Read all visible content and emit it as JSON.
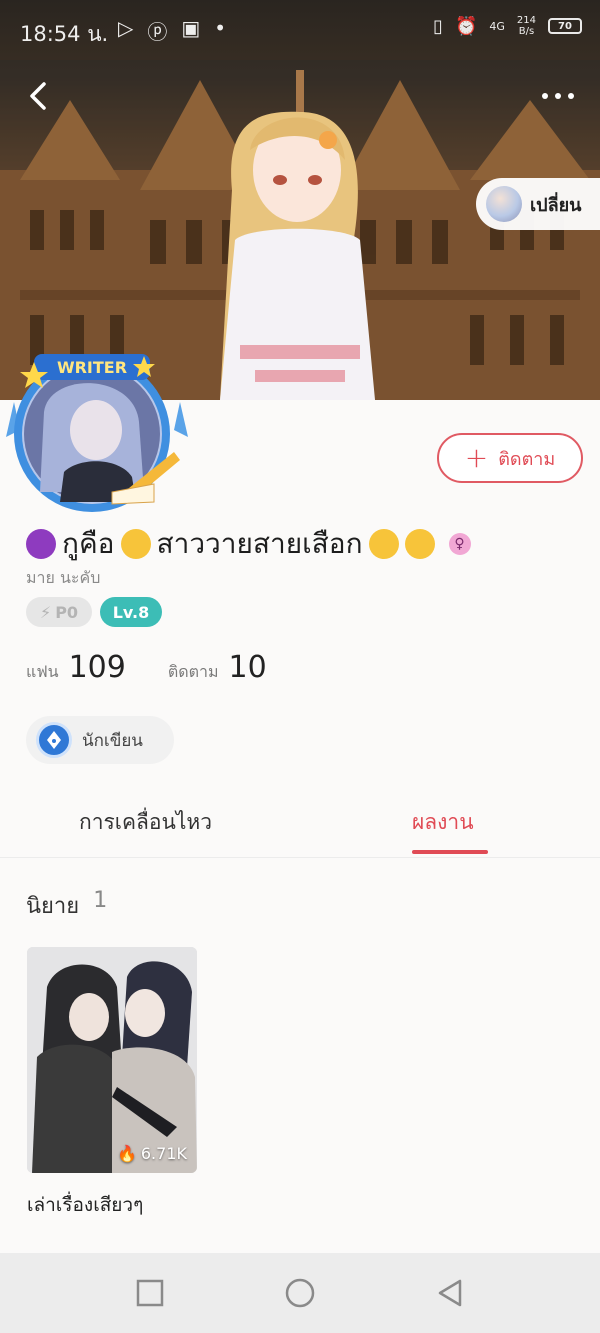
{
  "status_bar": {
    "time": "18:54 น.",
    "net_type": "4G",
    "speed": "214\nB/s",
    "battery": "70"
  },
  "header": {
    "change_label": "เปลี่ยน"
  },
  "avatar": {
    "frame_text": "WRITER"
  },
  "profile": {
    "name": "กูคือ",
    "name_middle": "สาววายสายเสือก",
    "subname": "มาย นะคับ",
    "badge_p": "P0",
    "badge_level": "Lv.8",
    "follow_label": "ติดตาม"
  },
  "stats": {
    "fans_label": "แฟน",
    "fans_value": "109",
    "following_label": "ติดตาม",
    "following_value": "10"
  },
  "writer_chip": {
    "label": "นักเขียน"
  },
  "tabs": {
    "activity": "การเคลื่อนไหว",
    "works": "ผลงาน"
  },
  "works": {
    "section_label": "นิยาย",
    "count": "1",
    "items": [
      {
        "title": "เล่าเรื่องเสียวๆ",
        "views": "6.71K"
      }
    ]
  },
  "colors": {
    "accent": "#e04b55",
    "level_badge": "#3cbdb6",
    "writer_icon": "#2f78d6"
  },
  "icons": [
    "back-icon",
    "more-icon",
    "plus-icon",
    "pen-nib-icon",
    "female-icon",
    "flame-icon",
    "square-icon",
    "circle-icon",
    "triangle-back-icon"
  ]
}
